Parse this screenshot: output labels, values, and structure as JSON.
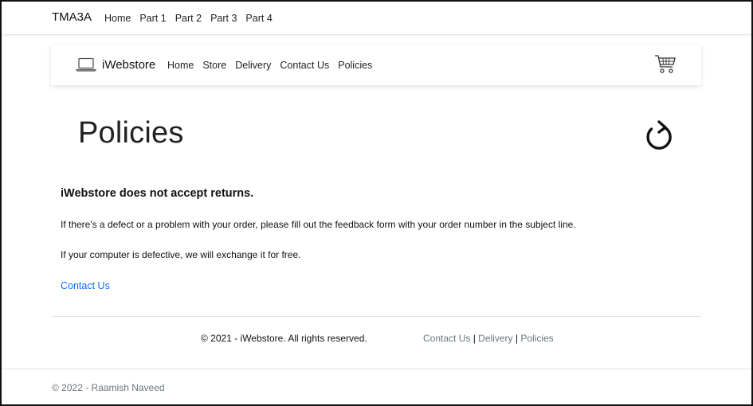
{
  "topnav": {
    "brand": "TMA3A",
    "links": [
      "Home",
      "Part 1",
      "Part 2",
      "Part 3",
      "Part 4"
    ]
  },
  "storenav": {
    "brand": "iWebstore",
    "links": [
      "Home",
      "Store",
      "Delivery",
      "Contact Us",
      "Policies"
    ],
    "icons": {
      "logo": "laptop-icon",
      "cart": "cart-icon"
    }
  },
  "main": {
    "title": "Policies",
    "refresh_icon": "refresh-icon",
    "heading": "iWebstore does not accept returns.",
    "paragraph1": "If there's a defect or a problem with your order, please fill out the feedback form with your order number in the subject line.",
    "paragraph2": "If your computer is defective, we will exchange it for free.",
    "contact_link": "Contact Us"
  },
  "footer": {
    "copyright": "© 2021 - iWebstore. All rights reserved.",
    "links": [
      "Contact Us",
      "Delivery",
      "Policies"
    ],
    "separator": "|"
  },
  "bottom": {
    "copyright": "© 2022 - Raamish Naveed"
  },
  "colors": {
    "link": "#0d6efd",
    "muted": "#6c757d",
    "text": "#212529"
  }
}
